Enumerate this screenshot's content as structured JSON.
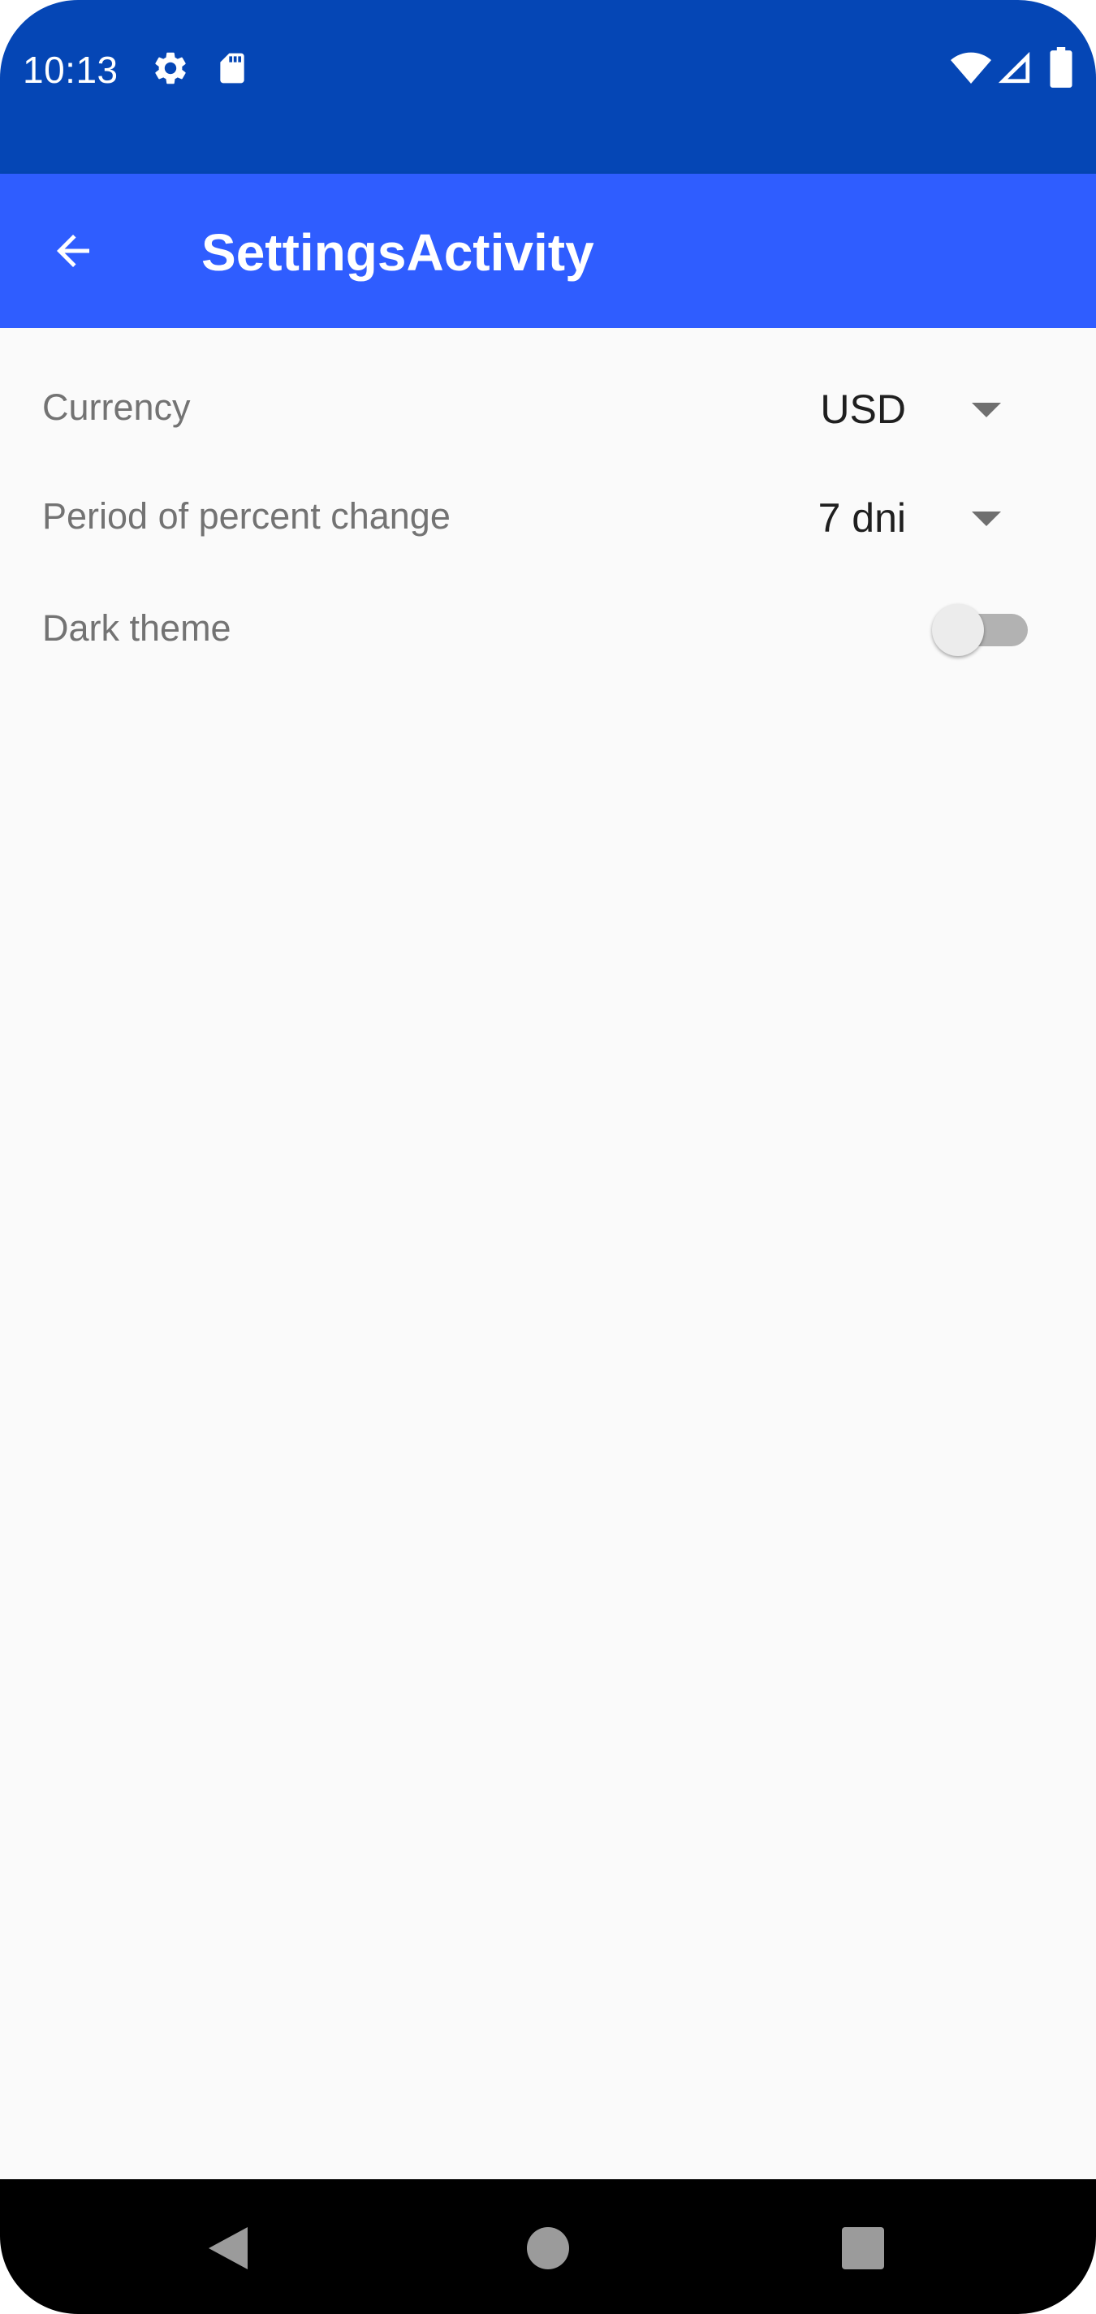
{
  "status_bar": {
    "time": "10:13",
    "color": "#0546b5",
    "icons": [
      "settings-gear-icon",
      "sd-card-icon",
      "wifi-icon",
      "cellular-signal-icon",
      "battery-icon"
    ]
  },
  "app_bar": {
    "title": "SettingsActivity",
    "color": "#2f5dff",
    "back_icon": "arrow-left-icon"
  },
  "settings": {
    "currency": {
      "label": "Currency",
      "value": "USD"
    },
    "period": {
      "label": "Period of percent change",
      "value": "7 dni"
    },
    "dark_theme": {
      "label": "Dark theme",
      "enabled": false
    }
  },
  "nav_bar": {
    "buttons": [
      "back-triangle-icon",
      "home-circle-icon",
      "recents-square-icon"
    ]
  }
}
